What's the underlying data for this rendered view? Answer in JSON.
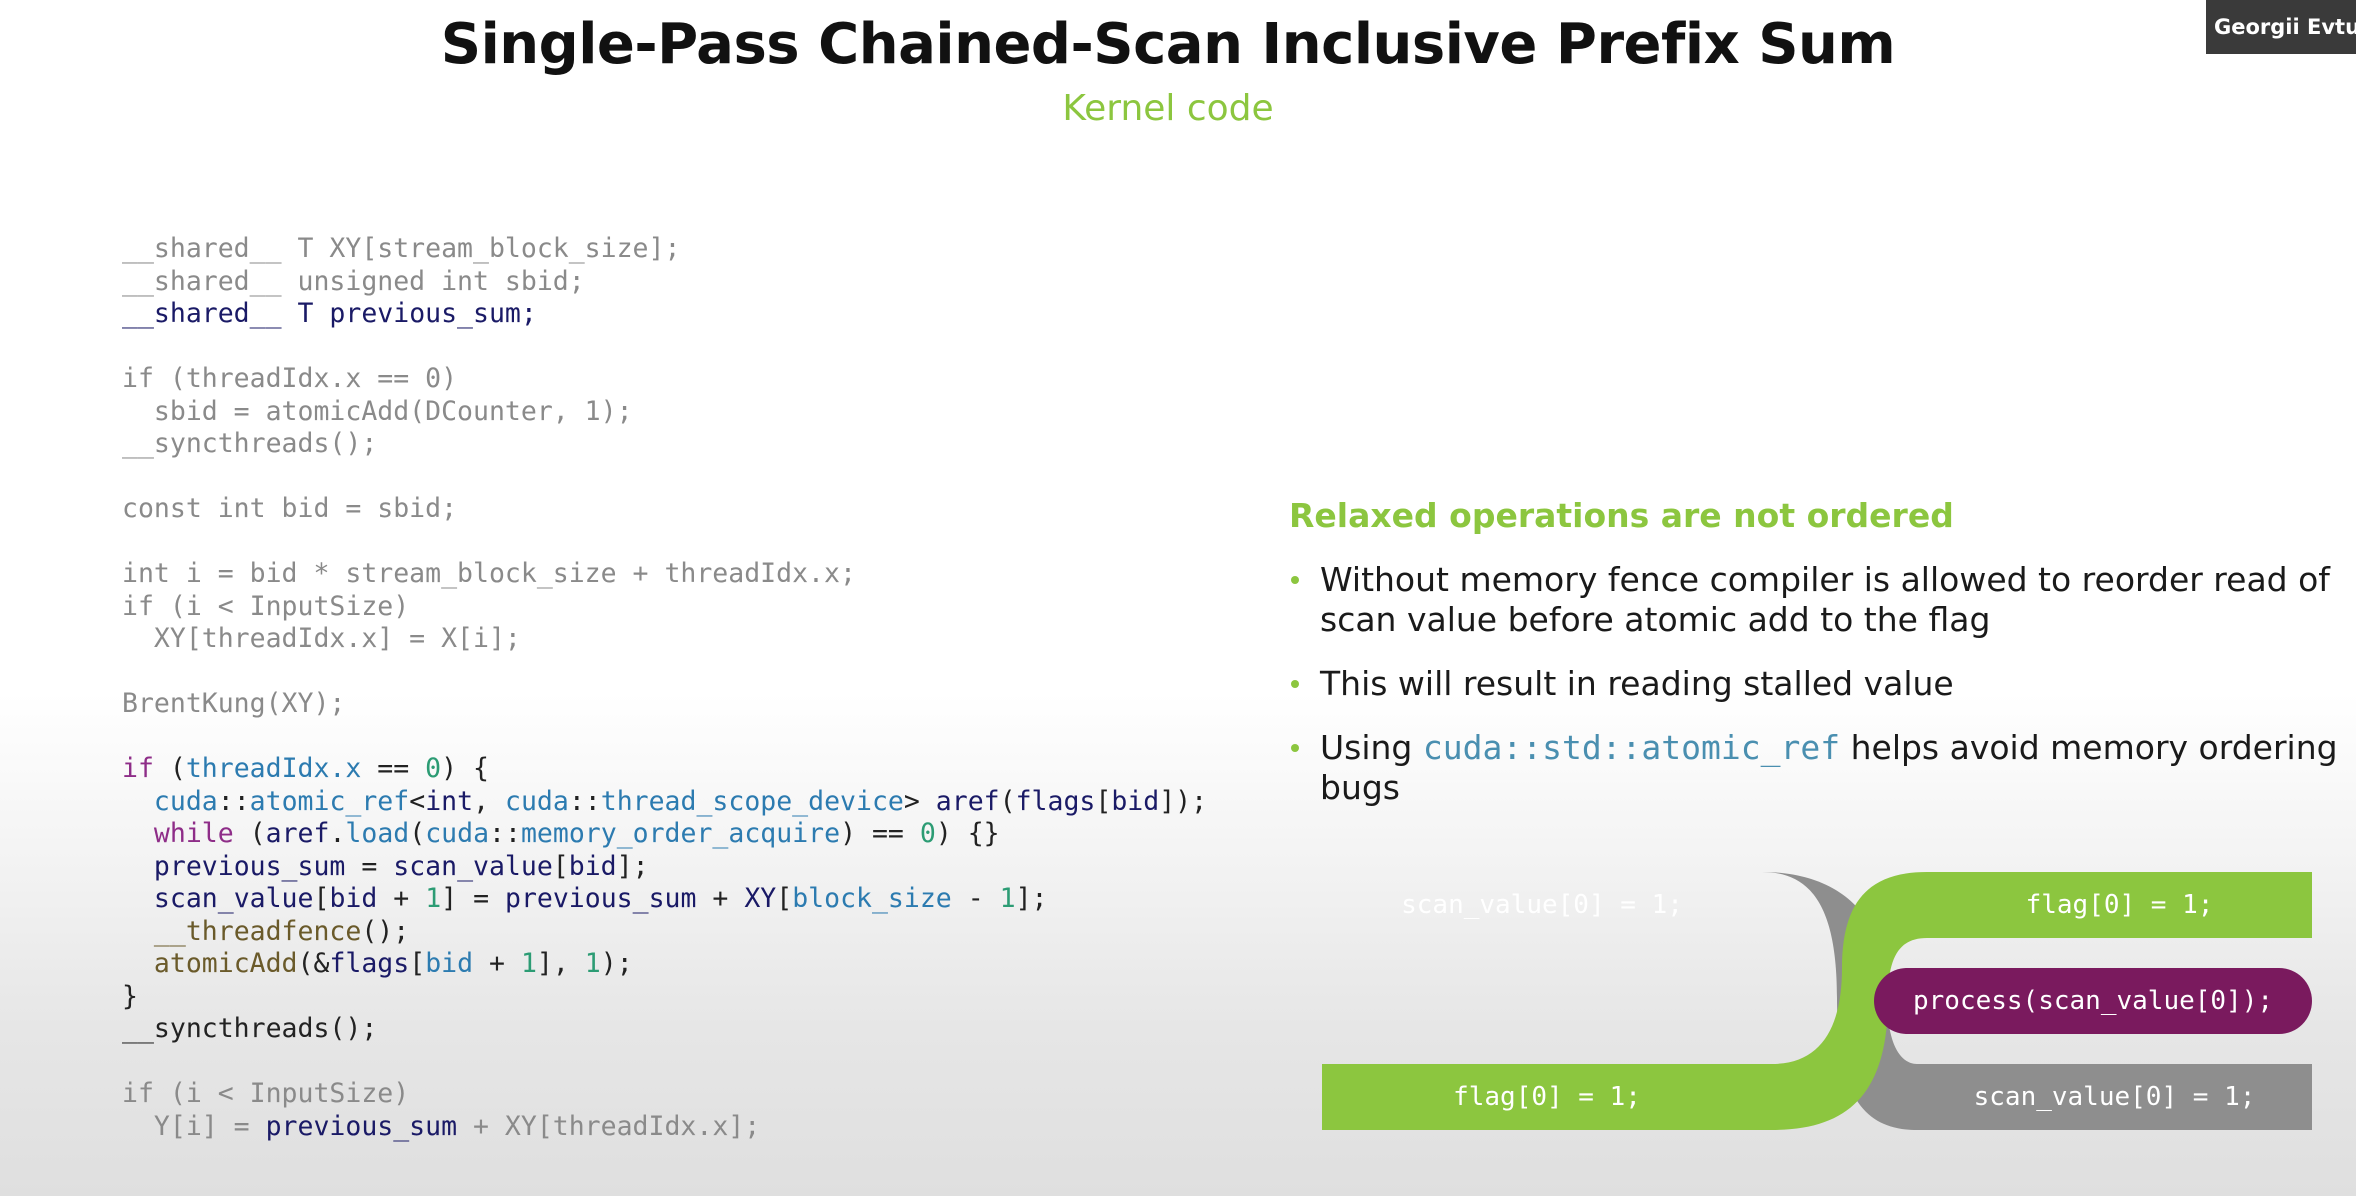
{
  "slide": {
    "title": "Single-Pass Chained-Scan Inclusive Prefix Sum",
    "subtitle": "Kernel code",
    "speaker_name": "Georgii Evtush"
  },
  "code": {
    "lines": [
      [
        {
          "t": "__shared__ T XY[stream_block_size];"
        }
      ],
      [
        {
          "t": "__shared__ unsigned int sbid;"
        }
      ],
      [
        {
          "t": "__shared__ T ",
          "c": "nm"
        },
        {
          "t": "previous_sum",
          "c": "nm"
        },
        {
          "t": ";",
          "c": "nm"
        }
      ],
      [],
      [
        {
          "t": "if (threadIdx.x == 0)"
        }
      ],
      [
        {
          "t": "  sbid = atomicAdd(DCounter, 1);"
        }
      ],
      [
        {
          "t": "__syncthreads();"
        }
      ],
      [],
      [
        {
          "t": "const int bid = sbid;"
        }
      ],
      [],
      [
        {
          "t": "int i = bid * stream_block_size + threadIdx.x;"
        }
      ],
      [
        {
          "t": "if (i < InputSize)"
        }
      ],
      [
        {
          "t": "  XY[threadIdx.x] = X[i];"
        }
      ],
      [],
      [
        {
          "t": "BrentKung(XY);"
        }
      ],
      [],
      [
        {
          "t": "if",
          "c": "kw"
        },
        {
          "t": " (",
          "c": "hl"
        },
        {
          "t": "threadIdx.x",
          "c": "ty"
        },
        {
          "t": " == ",
          "c": "hl"
        },
        {
          "t": "0",
          "c": "num"
        },
        {
          "t": ") {",
          "c": "hl"
        }
      ],
      [
        {
          "t": "  "
        },
        {
          "t": "cuda",
          "c": "ty"
        },
        {
          "t": "::",
          "c": "hl"
        },
        {
          "t": "atomic_ref",
          "c": "ty"
        },
        {
          "t": "<",
          "c": "hl"
        },
        {
          "t": "int",
          "c": "nm"
        },
        {
          "t": ", ",
          "c": "hl"
        },
        {
          "t": "cuda",
          "c": "ty"
        },
        {
          "t": "::",
          "c": "hl"
        },
        {
          "t": "thread_scope_device",
          "c": "ty"
        },
        {
          "t": "> ",
          "c": "hl"
        },
        {
          "t": "aref",
          "c": "nm"
        },
        {
          "t": "(",
          "c": "hl"
        },
        {
          "t": "flags",
          "c": "nm"
        },
        {
          "t": "[",
          "c": "hl"
        },
        {
          "t": "bid",
          "c": "nm"
        },
        {
          "t": "]);",
          "c": "hl"
        }
      ],
      [
        {
          "t": "  "
        },
        {
          "t": "while",
          "c": "kw"
        },
        {
          "t": " (",
          "c": "hl"
        },
        {
          "t": "aref",
          "c": "nm"
        },
        {
          "t": ".",
          "c": "hl"
        },
        {
          "t": "load",
          "c": "ty"
        },
        {
          "t": "(",
          "c": "hl"
        },
        {
          "t": "cuda",
          "c": "ty"
        },
        {
          "t": "::",
          "c": "hl"
        },
        {
          "t": "memory_order_acquire",
          "c": "ty"
        },
        {
          "t": ") == ",
          "c": "hl"
        },
        {
          "t": "0",
          "c": "num"
        },
        {
          "t": ") {}",
          "c": "hl"
        }
      ],
      [
        {
          "t": "  "
        },
        {
          "t": "previous_sum",
          "c": "nm"
        },
        {
          "t": " = ",
          "c": "hl"
        },
        {
          "t": "scan_value",
          "c": "nm"
        },
        {
          "t": "[",
          "c": "hl"
        },
        {
          "t": "bid",
          "c": "nm"
        },
        {
          "t": "];",
          "c": "hl"
        }
      ],
      [
        {
          "t": "  "
        },
        {
          "t": "scan_value",
          "c": "nm"
        },
        {
          "t": "[",
          "c": "hl"
        },
        {
          "t": "bid",
          "c": "nm"
        },
        {
          "t": " + ",
          "c": "hl"
        },
        {
          "t": "1",
          "c": "num"
        },
        {
          "t": "] = ",
          "c": "hl"
        },
        {
          "t": "previous_sum",
          "c": "nm"
        },
        {
          "t": " + ",
          "c": "hl"
        },
        {
          "t": "XY",
          "c": "nm"
        },
        {
          "t": "[",
          "c": "hl"
        },
        {
          "t": "block_size",
          "c": "ty"
        },
        {
          "t": " - ",
          "c": "hl"
        },
        {
          "t": "1",
          "c": "num"
        },
        {
          "t": "];",
          "c": "hl"
        }
      ],
      [
        {
          "t": "  "
        },
        {
          "t": "__threadfence",
          "c": "fn"
        },
        {
          "t": "();",
          "c": "hl"
        }
      ],
      [
        {
          "t": "  "
        },
        {
          "t": "atomicAdd",
          "c": "fn"
        },
        {
          "t": "(&",
          "c": "hl"
        },
        {
          "t": "flags",
          "c": "nm"
        },
        {
          "t": "[",
          "c": "hl"
        },
        {
          "t": "bid",
          "c": "ty"
        },
        {
          "t": " + ",
          "c": "hl"
        },
        {
          "t": "1",
          "c": "num"
        },
        {
          "t": "], ",
          "c": "hl"
        },
        {
          "t": "1",
          "c": "num"
        },
        {
          "t": ");",
          "c": "hl"
        }
      ],
      [
        {
          "t": "}",
          "c": "hl"
        }
      ],
      [
        {
          "t": "__syncthreads();",
          "c": "hl"
        }
      ],
      [],
      [
        {
          "t": "if (i < InputSize)"
        }
      ],
      [
        {
          "t": "  Y[i] = "
        },
        {
          "t": "previous_sum",
          "c": "nm"
        },
        {
          "t": " + XY[threadIdx.x];"
        }
      ]
    ]
  },
  "callout": {
    "heading": "Relaxed operations are not ordered",
    "bullets": [
      [
        {
          "t": "Without memory fence compiler is allowed to reorder read of scan value before atomic add to the flag"
        }
      ],
      [
        {
          "t": "This will result in reading stalled value"
        }
      ],
      [
        {
          "t": "Using "
        },
        {
          "t": "cuda::std::atomic_ref",
          "mono": true
        },
        {
          "t": " helps avoid memory ordering bugs"
        }
      ]
    ]
  },
  "diagram": {
    "colors": {
      "gray": "#8e8e8e",
      "green": "#8cc63f",
      "purple": "#7a1a5e"
    },
    "labels": {
      "top_left": "scan_value[0] = 1;",
      "top_right": "flag[0] = 1;",
      "middle_right": "process(scan_value[0]);",
      "bottom_left": "flag[0] = 1;",
      "bottom_right": "scan_value[0] = 1;"
    }
  }
}
